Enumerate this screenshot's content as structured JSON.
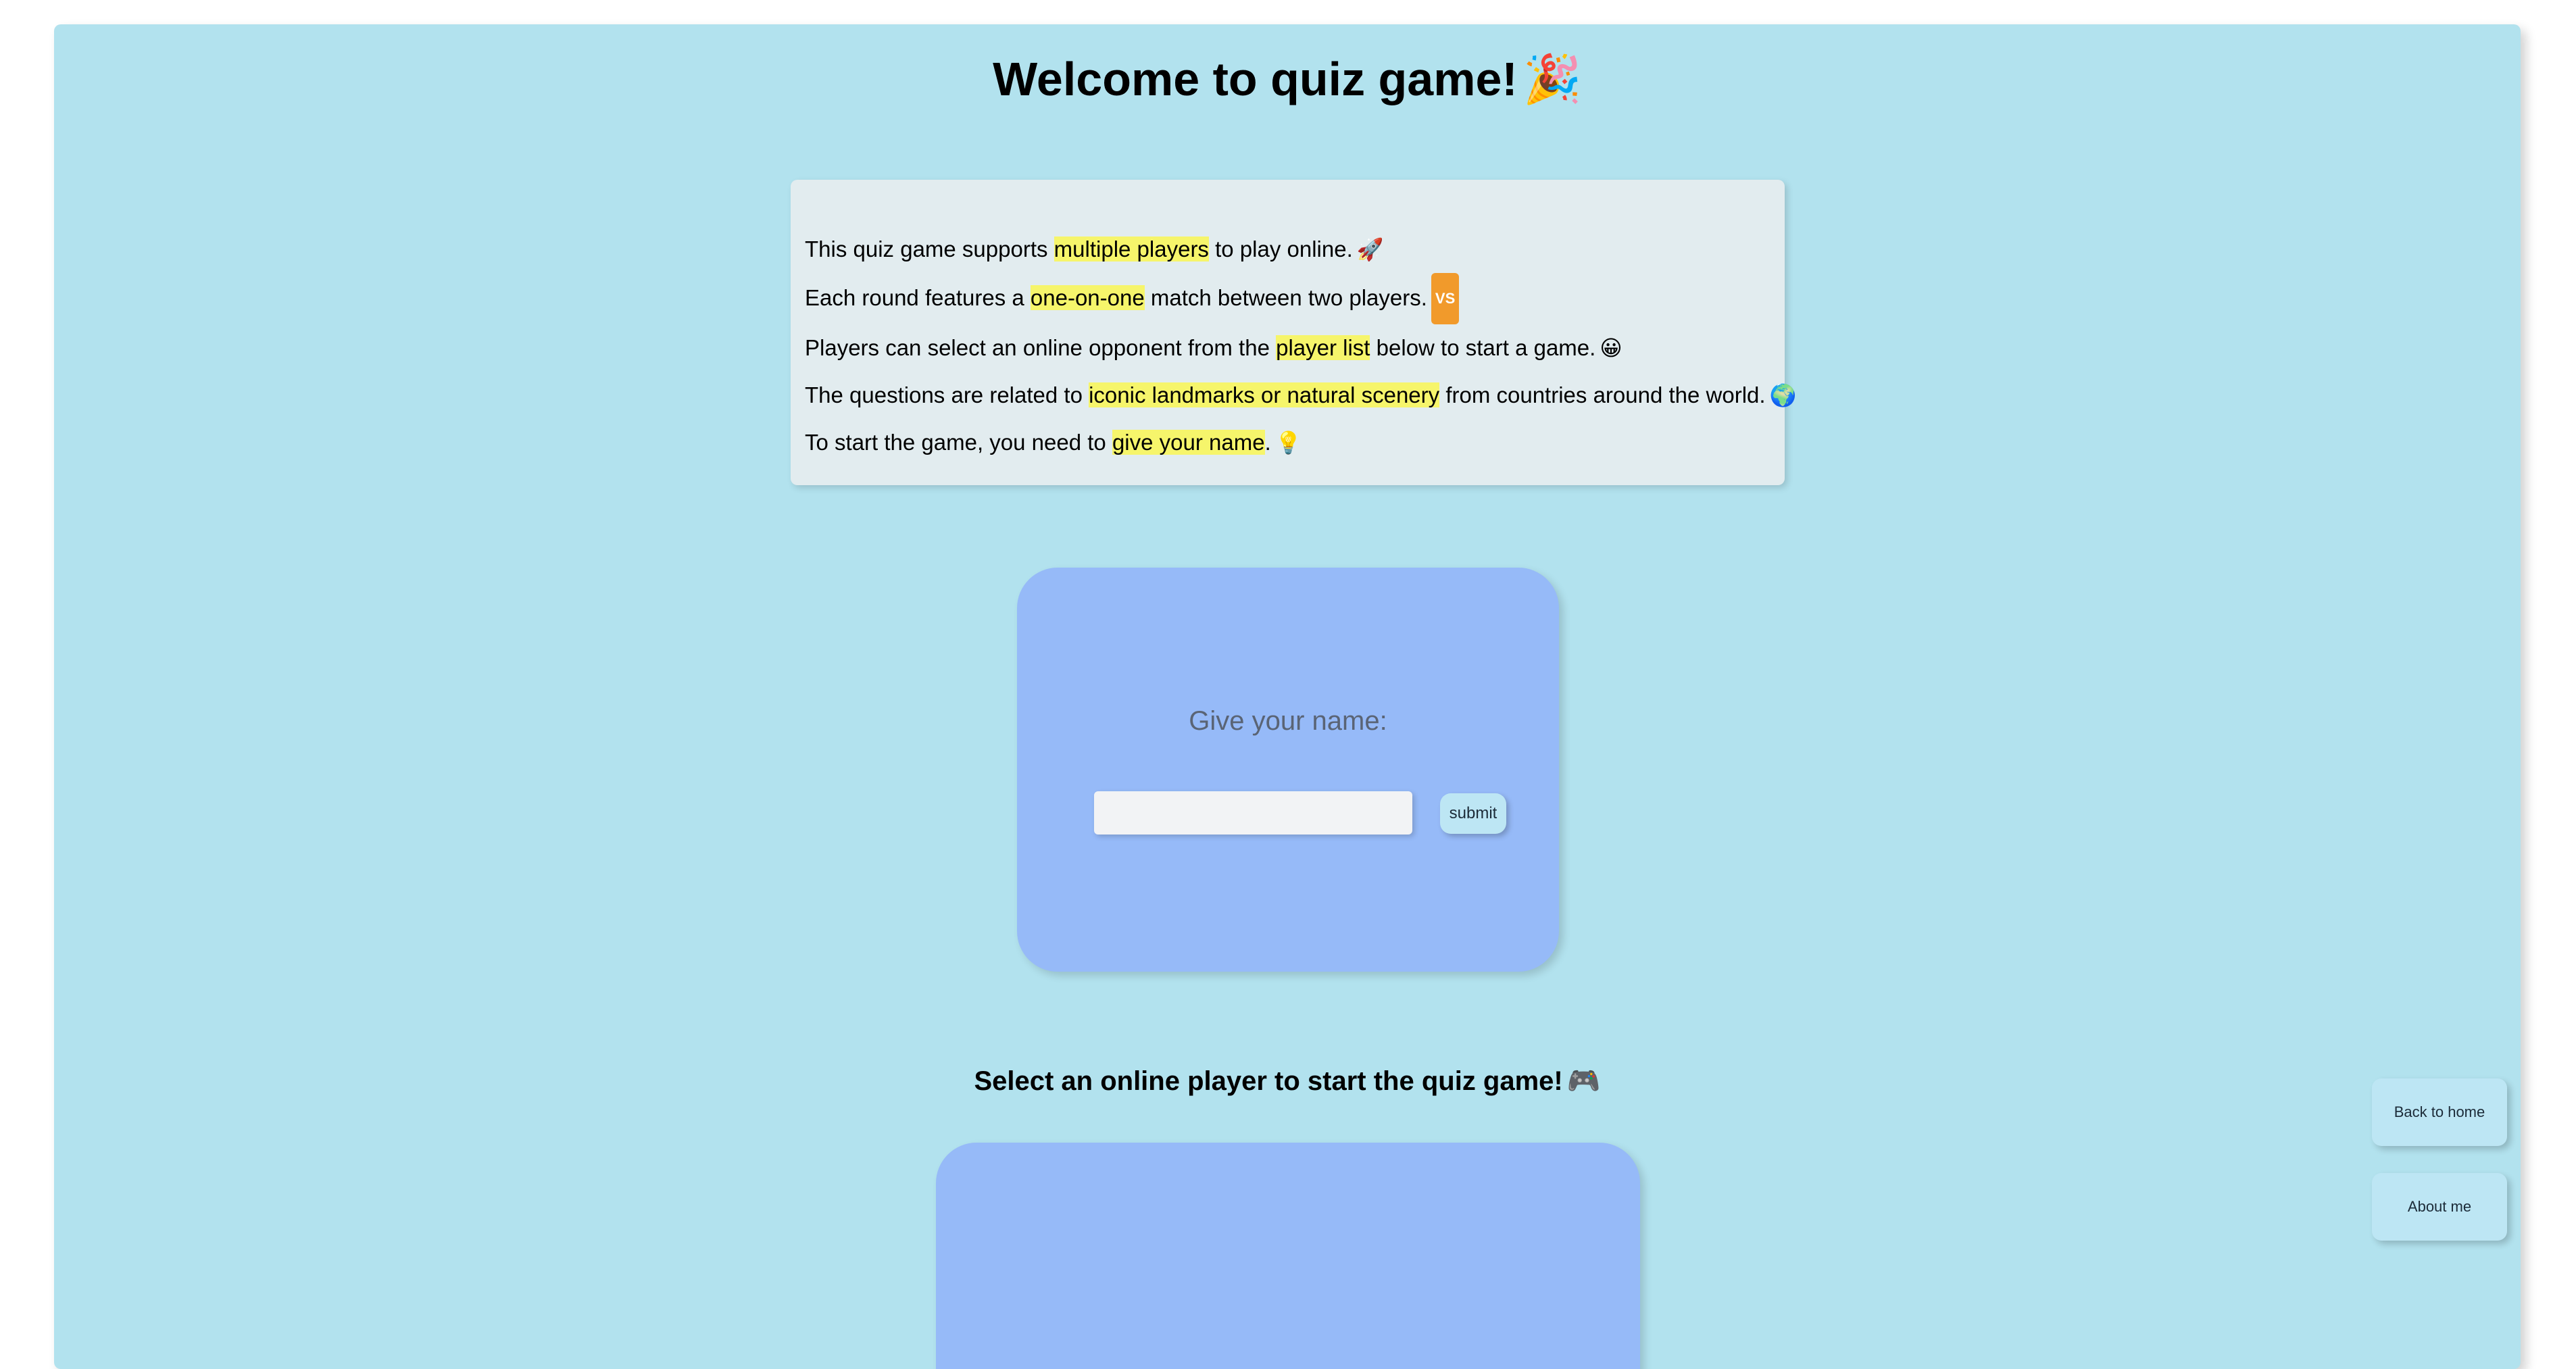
{
  "header": {
    "title": "Welcome to quiz game!",
    "title_emoji": "🎉"
  },
  "intro": {
    "lines": [
      {
        "before": "This quiz game supports ",
        "highlight": "multiple players",
        "after": " to play online.",
        "emoji": "🚀"
      },
      {
        "before": "Each round features a ",
        "highlight": "one-on-one",
        "after": " match between two players.",
        "emoji": "VS"
      },
      {
        "before": "Players can select an online opponent from the ",
        "highlight": "player list",
        "after": " below to start a game.",
        "emoji": "😀"
      },
      {
        "before": "The questions are related to ",
        "highlight": "iconic landmarks or natural scenery",
        "after": " from countries around the world.",
        "emoji": "🌍"
      },
      {
        "before": "To start the game, you need to ",
        "highlight": "give your name",
        "after": ".",
        "emoji": "💡"
      }
    ]
  },
  "name_form": {
    "label": "Give your name:",
    "input_value": "",
    "input_placeholder": "",
    "submit_label": "submit"
  },
  "player_select": {
    "heading": "Select an online player to start the quiz game!",
    "heading_emoji": "🎮"
  },
  "side_nav": {
    "home_label": "Back to home",
    "about_label": "About me"
  },
  "colors": {
    "page_bg": "#b2e2ee",
    "intro_bg": "#e2ecef",
    "highlight": "#f6f56b",
    "card_bg": "#96baf8",
    "button_bg": "#bde6f4"
  }
}
